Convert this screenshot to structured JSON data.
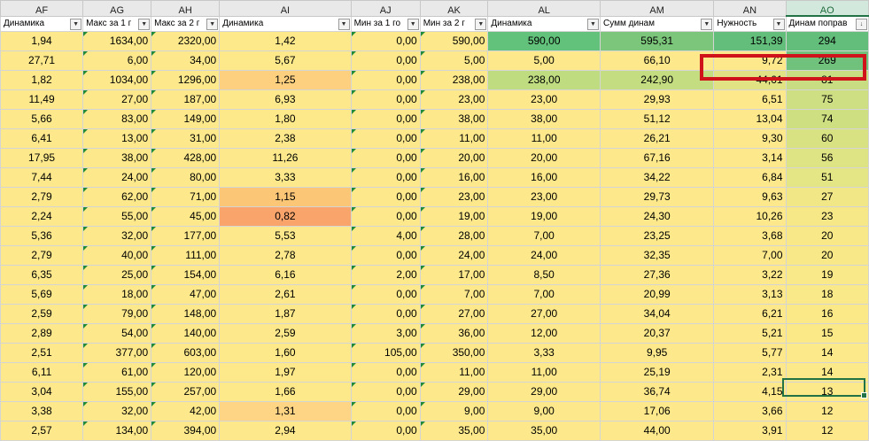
{
  "columns": [
    "AF",
    "AG",
    "AH",
    "AI",
    "AJ",
    "AK",
    "AL",
    "AM",
    "AN",
    "AO"
  ],
  "filters": [
    "Динамика",
    "Макс за 1 г",
    "Макс за 2 г",
    "Динамика",
    "Мин за 1 го",
    "Мин за 2 г",
    "Динамика",
    "Сумм динам",
    "Нужность",
    "Динам поправ"
  ],
  "rows": [
    [
      "1,94",
      "1634,00",
      "2320,00",
      "1,42",
      "0,00",
      "590,00",
      "590,00",
      "595,31",
      "151,39",
      "294"
    ],
    [
      "27,71",
      "6,00",
      "34,00",
      "5,67",
      "0,00",
      "5,00",
      "5,00",
      "66,10",
      "9,72",
      "269"
    ],
    [
      "1,82",
      "1034,00",
      "1296,00",
      "1,25",
      "0,00",
      "238,00",
      "238,00",
      "242,90",
      "44,61",
      "81"
    ],
    [
      "11,49",
      "27,00",
      "187,00",
      "6,93",
      "0,00",
      "23,00",
      "23,00",
      "29,93",
      "6,51",
      "75"
    ],
    [
      "5,66",
      "83,00",
      "149,00",
      "1,80",
      "0,00",
      "38,00",
      "38,00",
      "51,12",
      "13,04",
      "74"
    ],
    [
      "6,41",
      "13,00",
      "31,00",
      "2,38",
      "0,00",
      "11,00",
      "11,00",
      "26,21",
      "9,30",
      "60"
    ],
    [
      "17,95",
      "38,00",
      "428,00",
      "11,26",
      "0,00",
      "20,00",
      "20,00",
      "67,16",
      "3,14",
      "56"
    ],
    [
      "7,44",
      "24,00",
      "80,00",
      "3,33",
      "0,00",
      "16,00",
      "16,00",
      "34,22",
      "6,84",
      "51"
    ],
    [
      "2,79",
      "62,00",
      "71,00",
      "1,15",
      "0,00",
      "23,00",
      "23,00",
      "29,73",
      "9,63",
      "27"
    ],
    [
      "2,24",
      "55,00",
      "45,00",
      "0,82",
      "0,00",
      "19,00",
      "19,00",
      "24,30",
      "10,26",
      "23"
    ],
    [
      "5,36",
      "32,00",
      "177,00",
      "5,53",
      "4,00",
      "28,00",
      "7,00",
      "23,25",
      "3,68",
      "20"
    ],
    [
      "2,79",
      "40,00",
      "111,00",
      "2,78",
      "0,00",
      "24,00",
      "24,00",
      "32,35",
      "7,00",
      "20"
    ],
    [
      "6,35",
      "25,00",
      "154,00",
      "6,16",
      "2,00",
      "17,00",
      "8,50",
      "27,36",
      "3,22",
      "19"
    ],
    [
      "5,69",
      "18,00",
      "47,00",
      "2,61",
      "0,00",
      "7,00",
      "7,00",
      "20,99",
      "3,13",
      "18"
    ],
    [
      "2,59",
      "79,00",
      "148,00",
      "1,87",
      "0,00",
      "27,00",
      "27,00",
      "34,04",
      "6,21",
      "16"
    ],
    [
      "2,89",
      "54,00",
      "140,00",
      "2,59",
      "3,00",
      "36,00",
      "12,00",
      "20,37",
      "5,21",
      "15"
    ],
    [
      "2,51",
      "377,00",
      "603,00",
      "1,60",
      "105,00",
      "350,00",
      "3,33",
      "9,95",
      "5,77",
      "14"
    ],
    [
      "6,11",
      "61,00",
      "120,00",
      "1,97",
      "0,00",
      "11,00",
      "11,00",
      "25,19",
      "2,31",
      "14"
    ],
    [
      "3,04",
      "155,00",
      "257,00",
      "1,66",
      "0,00",
      "29,00",
      "29,00",
      "36,74",
      "4,15",
      "13"
    ],
    [
      "3,38",
      "32,00",
      "42,00",
      "1,31",
      "0,00",
      "9,00",
      "9,00",
      "17,06",
      "3,66",
      "12"
    ],
    [
      "2,57",
      "134,00",
      "394,00",
      "2,94",
      "0,00",
      "35,00",
      "35,00",
      "44,00",
      "3,91",
      "12"
    ]
  ],
  "colors": {
    "yellow": "#fde98b",
    "ai": [
      "#fde88a",
      "#fde88a",
      "#fdd080",
      "#fde98b",
      "#fde88a",
      "#fde98b",
      "#fde98b",
      "#fde98b",
      "#fcc677",
      "#f9a46b",
      "#fde98b",
      "#fde98b",
      "#fde98b",
      "#fde98b",
      "#fde98b",
      "#fde98b",
      "#fde88a",
      "#fde88a",
      "#fde88a",
      "#fdd585",
      "#fde98b"
    ],
    "al": [
      "#62c17a",
      "#fde98b",
      "#bfdc80",
      "#fde98b",
      "#fde98b",
      "#fde98b",
      "#fde98b",
      "#fde98b",
      "#fde98b",
      "#fde98b",
      "#fde98b",
      "#fde98b",
      "#fde98b",
      "#fde98b",
      "#fde98b",
      "#fde98b",
      "#fde98b",
      "#fde98b",
      "#fde98b",
      "#fde98b",
      "#fde98b"
    ],
    "am": [
      "#7cc67b",
      "#fde98b",
      "#c4dd81",
      "#fde98b",
      "#fde98b",
      "#fde98b",
      "#fde98b",
      "#fde98b",
      "#fde98b",
      "#fde98b",
      "#fde98b",
      "#fde98b",
      "#fde98b",
      "#fde98b",
      "#fde98b",
      "#fde98b",
      "#fde98b",
      "#fde98b",
      "#fde98b",
      "#fde98b",
      "#fde98b"
    ],
    "an": [
      "#63be7b",
      "#fde98b",
      "#e0e283",
      "#fde98b",
      "#fde98b",
      "#fde98b",
      "#fde98b",
      "#fde98b",
      "#fde98b",
      "#fde98b",
      "#fde98b",
      "#fde98b",
      "#fde98b",
      "#fde98b",
      "#fde98b",
      "#fde98b",
      "#fde98b",
      "#fde98b",
      "#fde98b",
      "#fde98b",
      "#fde98b"
    ],
    "ao": [
      "#63be7b",
      "#6fc17c",
      "#c8dd81",
      "#cddf82",
      "#cedf82",
      "#d9e283",
      "#dee383",
      "#e4e584",
      "#f2e786",
      "#f6e887",
      "#f8e887",
      "#f8e887",
      "#f9e988",
      "#fae988",
      "#fbe988",
      "#fbe988",
      "#fce98a",
      "#fce98a",
      "#fce98a",
      "#fde98b",
      "#fde98b"
    ]
  },
  "icons": {
    "filter": "dropdown-arrow-icon",
    "sort_filter": "sort-desc-filter-icon"
  }
}
